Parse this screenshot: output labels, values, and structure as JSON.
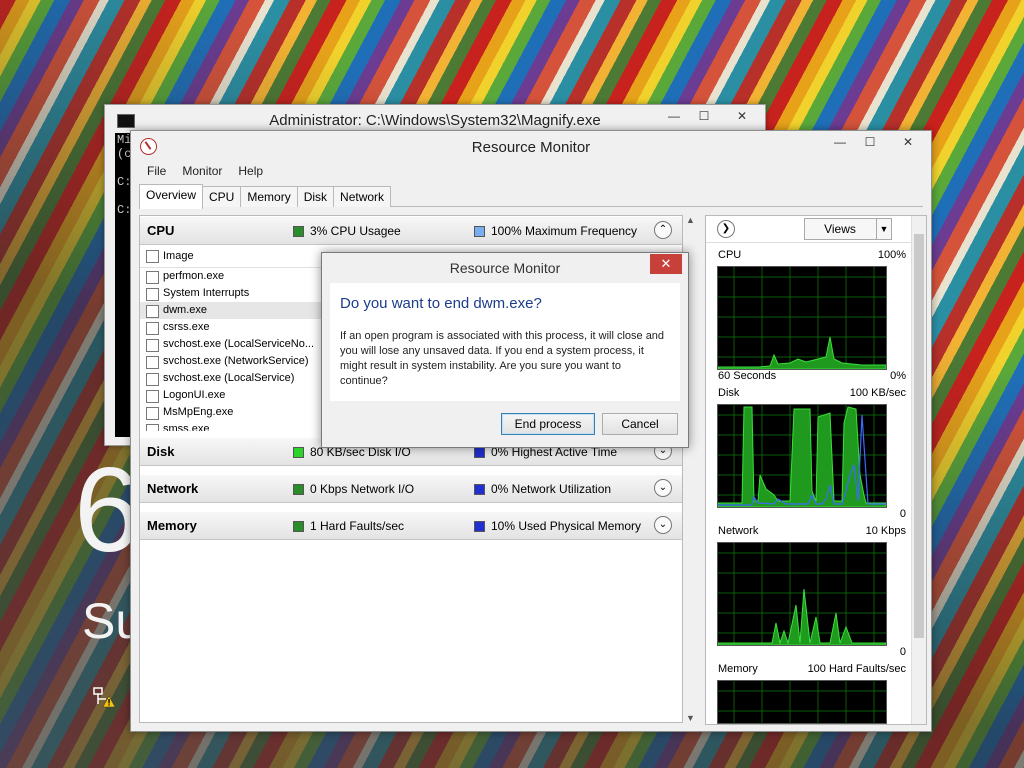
{
  "cmd": {
    "title": "Administrator: C:\\Windows\\System32\\Magnify.exe",
    "lines": [
      "Mi",
      "(c",
      "",
      "C:",
      "",
      "C:"
    ]
  },
  "lockscreen": {
    "big": "6",
    "sub": "Su"
  },
  "rm": {
    "title": "Resource Monitor",
    "menu": [
      "File",
      "Monitor",
      "Help"
    ],
    "tabs": [
      "Overview",
      "CPU",
      "Memory",
      "Disk",
      "Network"
    ],
    "cpu": {
      "name": "CPU",
      "ind1": "3% CPU Usagee",
      "ind2": "100% Maximum Frequency",
      "col_image": "Image",
      "processes": [
        "perfmon.exe",
        "System Interrupts",
        "dwm.exe",
        "csrss.exe",
        "svchost.exe (LocalServiceNo...",
        "svchost.exe (NetworkService)",
        "svchost.exe (LocalService)",
        "LogonUI.exe",
        "MsMpEng.exe",
        "smss.exe"
      ]
    },
    "disk": {
      "name": "Disk",
      "ind1": "80 KB/sec Disk I/O",
      "ind2": "0% Highest Active Time"
    },
    "network": {
      "name": "Network",
      "ind1": "0 Kbps Network I/O",
      "ind2": "0% Network Utilization"
    },
    "memory": {
      "name": "Memory",
      "ind1": "1 Hard Faults/sec",
      "ind2": "10% Used Physical Memory"
    },
    "right": {
      "views": "Views",
      "cpu_label": "CPU",
      "cpu_max": "100%",
      "cpu_time": "60 Seconds",
      "cpu_min": "0%",
      "disk_label": "Disk",
      "disk_max": "100 KB/sec",
      "disk_min": "0",
      "net_label": "Network",
      "net_max": "10 Kbps",
      "net_min": "0",
      "mem_label": "Memory",
      "mem_max": "100 Hard Faults/sec"
    }
  },
  "dialog": {
    "title": "Resource Monitor",
    "heading": "Do you want to end dwm.exe?",
    "text": "If an open program is associated with this process, it will close and you will lose any unsaved data. If you end a system process, it might result in system instability. Are you sure you want to continue?",
    "end_label": "End process",
    "cancel_label": "Cancel",
    "close_glyph": "✕"
  },
  "colors": {
    "graph_green": "#27c227",
    "graph_blue": "#3e69ff",
    "dialog_heading": "#1c3c8c",
    "close_red": "#c7413a"
  }
}
